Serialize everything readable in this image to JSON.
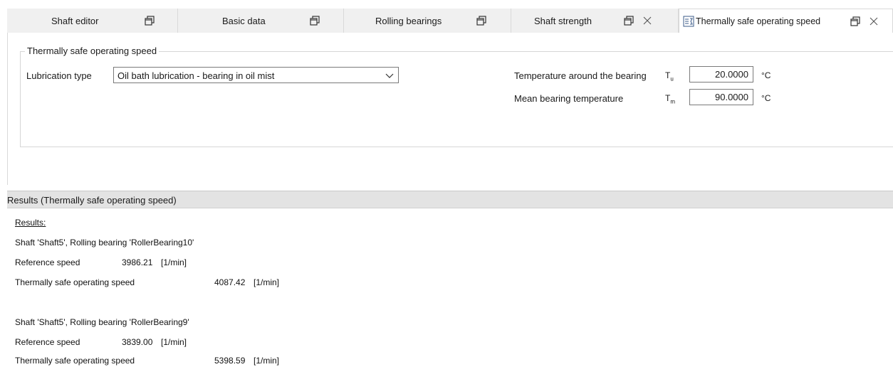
{
  "tabs": [
    {
      "label": "Shaft editor",
      "active": false,
      "closable": false
    },
    {
      "label": "Basic data",
      "active": false,
      "closable": false
    },
    {
      "label": "Rolling bearings",
      "active": false,
      "closable": false
    },
    {
      "label": "Shaft strength",
      "active": false,
      "closable": true
    },
    {
      "label": "Thermally safe operating speed",
      "active": true,
      "closable": true
    }
  ],
  "group": {
    "title": "Thermally safe operating speed",
    "lubrication_label": "Lubrication type",
    "lubrication_value": "Oil bath lubrication - bearing in oil mist",
    "temp_around_label": "Temperature around the bearing",
    "temp_around_symbol": "T",
    "temp_around_sub": "u",
    "temp_around_value": "20.0000",
    "temp_around_unit": "°C",
    "mean_temp_label": "Mean bearing temperature",
    "mean_temp_symbol": "T",
    "mean_temp_sub": "m",
    "mean_temp_value": "90.0000",
    "mean_temp_unit": "°C"
  },
  "results": {
    "header": "Results (Thermally safe operating speed)",
    "title": "Results:",
    "entries": [
      {
        "heading": "Shaft 'Shaft5', Rolling bearing 'RollerBearing10'",
        "ref_label": "Reference speed",
        "ref_value": "3986.21",
        "ref_unit": "[1/min]",
        "safe_label": "Thermally safe operating speed",
        "safe_value": "4087.42",
        "safe_unit": "[1/min]"
      },
      {
        "heading": "Shaft 'Shaft5', Rolling bearing 'RollerBearing9'",
        "ref_label": "Reference speed",
        "ref_value": "3839.00",
        "ref_unit": "[1/min]",
        "safe_label": "Thermally safe operating speed",
        "safe_value": "5398.59",
        "safe_unit": "[1/min]"
      }
    ]
  },
  "icons": {
    "window": "restore-window-icon",
    "close": "close-icon",
    "calc": "calculation-sheet-icon",
    "dropdown": "chevron-down-icon"
  },
  "colors": {
    "tab_background": "#f0f0f0",
    "active_tab": "#ffffff",
    "results_header": "#e3e3e3",
    "border": "#d9d9d9"
  }
}
